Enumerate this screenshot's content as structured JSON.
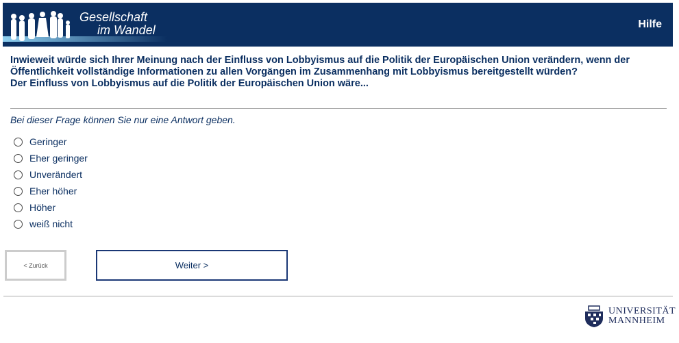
{
  "header": {
    "logo_line1": "Gesellschaft",
    "logo_line2": "im Wandel",
    "help_label": "Hilfe"
  },
  "question": {
    "line1": "Inwieweit würde sich Ihrer Meinung nach der Einfluss von Lobbyismus auf die Politik der Europäischen Union verändern, wenn der Öffentlichkeit vollständige Informationen zu allen Vorgängen im Zusammenhang mit Lobbyismus bereitgestellt würden?",
    "line2": "Der Einfluss von Lobbyismus auf die Politik der Europäischen Union wäre..."
  },
  "hint": "Bei dieser Frage können Sie nur eine Antwort geben.",
  "options": [
    "Geringer",
    "Eher geringer",
    "Unverändert",
    "Eher höher",
    "Höher",
    "weiß nicht"
  ],
  "nav": {
    "back_label": "< Zurück",
    "next_label": "Weiter >"
  },
  "footer": {
    "uni_line1": "UNIVERSITÄT",
    "uni_line2": "MANNHEIM"
  }
}
